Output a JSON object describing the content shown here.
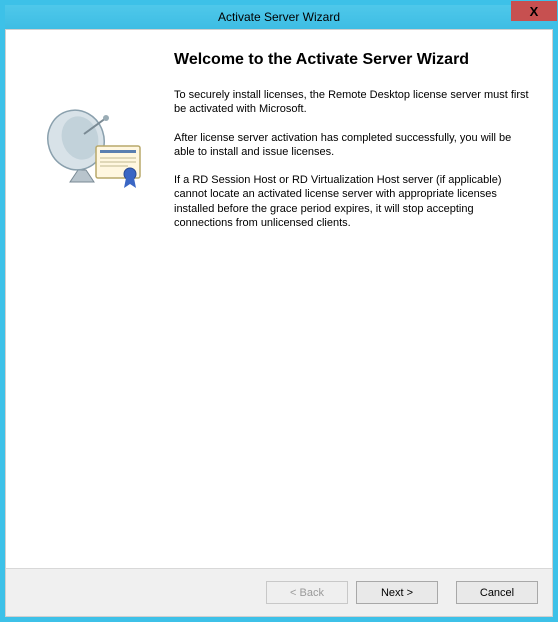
{
  "window": {
    "title": "Activate Server Wizard",
    "close_label": "X"
  },
  "content": {
    "heading": "Welcome to the Activate Server Wizard",
    "para1": "To securely install licenses, the Remote Desktop license server must first be activated with Microsoft.",
    "para2": "After license server activation has completed successfully, you will be able to install and issue licenses.",
    "para3": "If a RD Session Host or RD Virtualization Host server (if applicable) cannot locate an activated license server with appropriate licenses installed before the grace period expires, it will stop accepting connections from unlicensed clients."
  },
  "buttons": {
    "back": "< Back",
    "next": "Next >",
    "cancel": "Cancel"
  },
  "icons": {
    "wizard": "satellite-license-icon",
    "close": "close-icon"
  }
}
